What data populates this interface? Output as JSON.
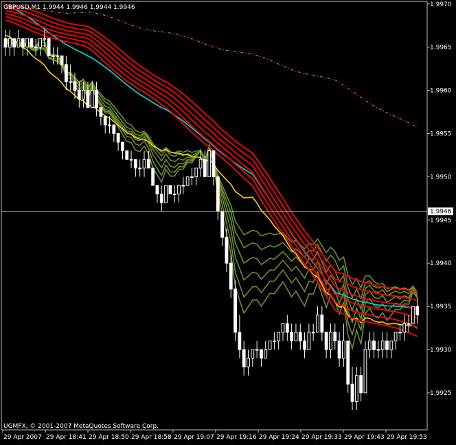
{
  "header": {
    "text": "GBPUSD,M1  1.9944 1.9946 1.9944 1.9946"
  },
  "copyright": "UGMFX, © 2001-2007 MetaQuotes Software Corp.",
  "current_price_label": "1.9946",
  "colors": {
    "background": "#000000",
    "axis": "#c0c0c0",
    "candle": "#ffffff",
    "price_line": "#c0c0c0",
    "slow_ma": "#ff7f00",
    "red_band": "#ff0000",
    "cyan_band": "#00c8d0",
    "yellow_band": "#ffd000",
    "green_band": "#6b8e23"
  },
  "chart_data": {
    "type": "candlestick",
    "symbol": "GBPUSD",
    "timeframe": "M1",
    "y_ticks": [
      "1.9970",
      "1.9965",
      "1.9960",
      "1.9955",
      "1.9950",
      "1.9945",
      "1.9940",
      "1.9935",
      "1.9930",
      "1.9925"
    ],
    "ylim": [
      1.99207,
      1.99703
    ],
    "x_ticks": [
      "29 Apr 2007",
      "29 Apr 18:41",
      "29 Apr 18:50",
      "29 Apr 18:58",
      "29 Apr 19:07",
      "29 Apr 19:16",
      "29 Apr 19:24",
      "29 Apr 19:33",
      "29 Apr 19:43",
      "29 Apr 19:53"
    ],
    "current_price": 1.9946,
    "candles": [
      [
        1.9966,
        1.9967,
        1.9964,
        1.9965
      ],
      [
        1.9965,
        1.9967,
        1.9964,
        1.9966
      ],
      [
        1.9966,
        1.9966,
        1.9964,
        1.9965
      ],
      [
        1.9965,
        1.9967,
        1.9965,
        1.9966
      ],
      [
        1.9966,
        1.9966,
        1.9964,
        1.9965
      ],
      [
        1.9965,
        1.9966,
        1.9964,
        1.9966
      ],
      [
        1.9966,
        1.9966,
        1.9965,
        1.9965
      ],
      [
        1.9965,
        1.9966,
        1.9964,
        1.9965
      ],
      [
        1.9965,
        1.9966,
        1.9964,
        1.9966
      ],
      [
        1.9966,
        1.9967,
        1.9965,
        1.9966
      ],
      [
        1.9966,
        1.9966,
        1.9964,
        1.9964
      ],
      [
        1.9964,
        1.9965,
        1.9963,
        1.9964
      ],
      [
        1.9964,
        1.9965,
        1.9963,
        1.9964
      ],
      [
        1.9964,
        1.9964,
        1.9962,
        1.9963
      ],
      [
        1.9963,
        1.9964,
        1.996,
        1.9961
      ],
      [
        1.9961,
        1.9963,
        1.996,
        1.9961
      ],
      [
        1.9961,
        1.9962,
        1.9959,
        1.996
      ],
      [
        1.996,
        1.9961,
        1.9958,
        1.9959
      ],
      [
        1.9959,
        1.9961,
        1.9958,
        1.996
      ],
      [
        1.996,
        1.9961,
        1.9958,
        1.9958
      ],
      [
        1.9958,
        1.9961,
        1.9958,
        1.996
      ],
      [
        1.996,
        1.9961,
        1.9957,
        1.9958
      ],
      [
        1.9958,
        1.9958,
        1.9956,
        1.9957
      ],
      [
        1.9957,
        1.9957,
        1.9955,
        1.9956
      ],
      [
        1.9956,
        1.9957,
        1.9955,
        1.9956
      ],
      [
        1.9956,
        1.9956,
        1.9954,
        1.9955
      ],
      [
        1.9955,
        1.9955,
        1.9953,
        1.9954
      ],
      [
        1.9954,
        1.9954,
        1.9952,
        1.9953
      ],
      [
        1.9953,
        1.9953,
        1.9952,
        1.9952
      ],
      [
        1.9952,
        1.9953,
        1.9951,
        1.9952
      ],
      [
        1.9952,
        1.9952,
        1.995,
        1.9951
      ],
      [
        1.9951,
        1.9952,
        1.995,
        1.9951
      ],
      [
        1.9951,
        1.9953,
        1.995,
        1.9952
      ],
      [
        1.9952,
        1.9953,
        1.9951,
        1.9951
      ],
      [
        1.9951,
        1.9951,
        1.9949,
        1.9949
      ],
      [
        1.9949,
        1.9949,
        1.9947,
        1.9948
      ],
      [
        1.9948,
        1.9949,
        1.9946,
        1.9947
      ],
      [
        1.9947,
        1.9949,
        1.9947,
        1.9949
      ],
      [
        1.9949,
        1.9949,
        1.9948,
        1.9948
      ],
      [
        1.9948,
        1.9949,
        1.9947,
        1.9948
      ],
      [
        1.9948,
        1.9949,
        1.9947,
        1.9949
      ],
      [
        1.9949,
        1.995,
        1.9948,
        1.9949
      ],
      [
        1.9949,
        1.995,
        1.9949,
        1.995
      ],
      [
        1.995,
        1.9951,
        1.9949,
        1.995
      ],
      [
        1.995,
        1.9951,
        1.9949,
        1.9951
      ],
      [
        1.9951,
        1.9953,
        1.995,
        1.9952
      ],
      [
        1.9952,
        1.9953,
        1.995,
        1.995
      ],
      [
        1.995,
        1.9953,
        1.995,
        1.9953
      ],
      [
        1.9953,
        1.9953,
        1.9949,
        1.995
      ],
      [
        1.995,
        1.995,
        1.9945,
        1.9946
      ],
      [
        1.9946,
        1.9946,
        1.9942,
        1.9943
      ],
      [
        1.9943,
        1.9944,
        1.9939,
        1.994
      ],
      [
        1.994,
        1.9941,
        1.9936,
        1.9937
      ],
      [
        1.9937,
        1.9938,
        1.9931,
        1.9932
      ],
      [
        1.9932,
        1.9934,
        1.9929,
        1.993
      ],
      [
        1.993,
        1.9931,
        1.9927,
        1.9928
      ],
      [
        1.9928,
        1.993,
        1.9927,
        1.9929
      ],
      [
        1.9929,
        1.993,
        1.9928,
        1.993
      ],
      [
        1.993,
        1.9931,
        1.9929,
        1.993
      ],
      [
        1.993,
        1.993,
        1.9928,
        1.9929
      ],
      [
        1.9929,
        1.9931,
        1.9929,
        1.993
      ],
      [
        1.993,
        1.9931,
        1.993,
        1.9931
      ],
      [
        1.9931,
        1.9932,
        1.993,
        1.9931
      ],
      [
        1.9931,
        1.9932,
        1.993,
        1.9932
      ],
      [
        1.9932,
        1.9933,
        1.9931,
        1.9933
      ],
      [
        1.9933,
        1.9934,
        1.9931,
        1.9932
      ],
      [
        1.9932,
        1.9933,
        1.993,
        1.9931
      ],
      [
        1.9931,
        1.9933,
        1.9931,
        1.9932
      ],
      [
        1.9932,
        1.9933,
        1.993,
        1.9931
      ],
      [
        1.9931,
        1.9932,
        1.9929,
        1.993
      ],
      [
        1.993,
        1.9933,
        1.993,
        1.9932
      ],
      [
        1.9932,
        1.9933,
        1.9931,
        1.9932
      ],
      [
        1.9932,
        1.9935,
        1.9932,
        1.9934
      ],
      [
        1.9934,
        1.9935,
        1.9931,
        1.9932
      ],
      [
        1.9932,
        1.9932,
        1.9929,
        1.993
      ],
      [
        1.993,
        1.9933,
        1.9929,
        1.9932
      ],
      [
        1.9932,
        1.9933,
        1.993,
        1.9931
      ],
      [
        1.9931,
        1.9932,
        1.9928,
        1.9929
      ],
      [
        1.9929,
        1.9933,
        1.9928,
        1.9931
      ],
      [
        1.9931,
        1.9931,
        1.9925,
        1.9926
      ],
      [
        1.9926,
        1.9928,
        1.9923,
        1.9924
      ],
      [
        1.9924,
        1.9928,
        1.9923,
        1.9927
      ],
      [
        1.9927,
        1.9928,
        1.9924,
        1.9925
      ],
      [
        1.9925,
        1.9931,
        1.9925,
        1.993
      ],
      [
        1.993,
        1.9932,
        1.9929,
        1.9931
      ],
      [
        1.9931,
        1.9932,
        1.9929,
        1.993
      ],
      [
        1.993,
        1.9931,
        1.9929,
        1.993
      ],
      [
        1.993,
        1.9932,
        1.9929,
        1.9931
      ],
      [
        1.9931,
        1.9932,
        1.9929,
        1.993
      ],
      [
        1.993,
        1.9931,
        1.9929,
        1.9931
      ],
      [
        1.9931,
        1.9932,
        1.993,
        1.9932
      ],
      [
        1.9932,
        1.9933,
        1.9931,
        1.9932
      ],
      [
        1.9932,
        1.9934,
        1.9931,
        1.9933
      ],
      [
        1.9933,
        1.9934,
        1.9932,
        1.9933
      ],
      [
        1.9933,
        1.9935,
        1.9933,
        1.9935
      ],
      [
        1.9935,
        1.9936,
        1.9933,
        1.9934
      ]
    ],
    "bands": {
      "red": [
        1.997,
        1.99675,
        1.99608,
        1.9953,
        1.9939,
        1.99365
      ],
      "cyan": [
        1.997,
        1.9964,
        1.99575,
        1.99505,
        1.99365,
        1.99345
      ],
      "green": [
        1.9966,
        1.9962,
        1.9956,
        1.9952,
        1.9948,
        1.99395
      ],
      "yellow": [
        1.99665,
        1.9958,
        1.99535,
        1.99505,
        1.9936,
        1.9932
      ]
    },
    "slow_ma": [
      1.99695,
      1.9969,
      1.99665,
      1.9964,
      1.9961,
      1.99555
    ]
  }
}
